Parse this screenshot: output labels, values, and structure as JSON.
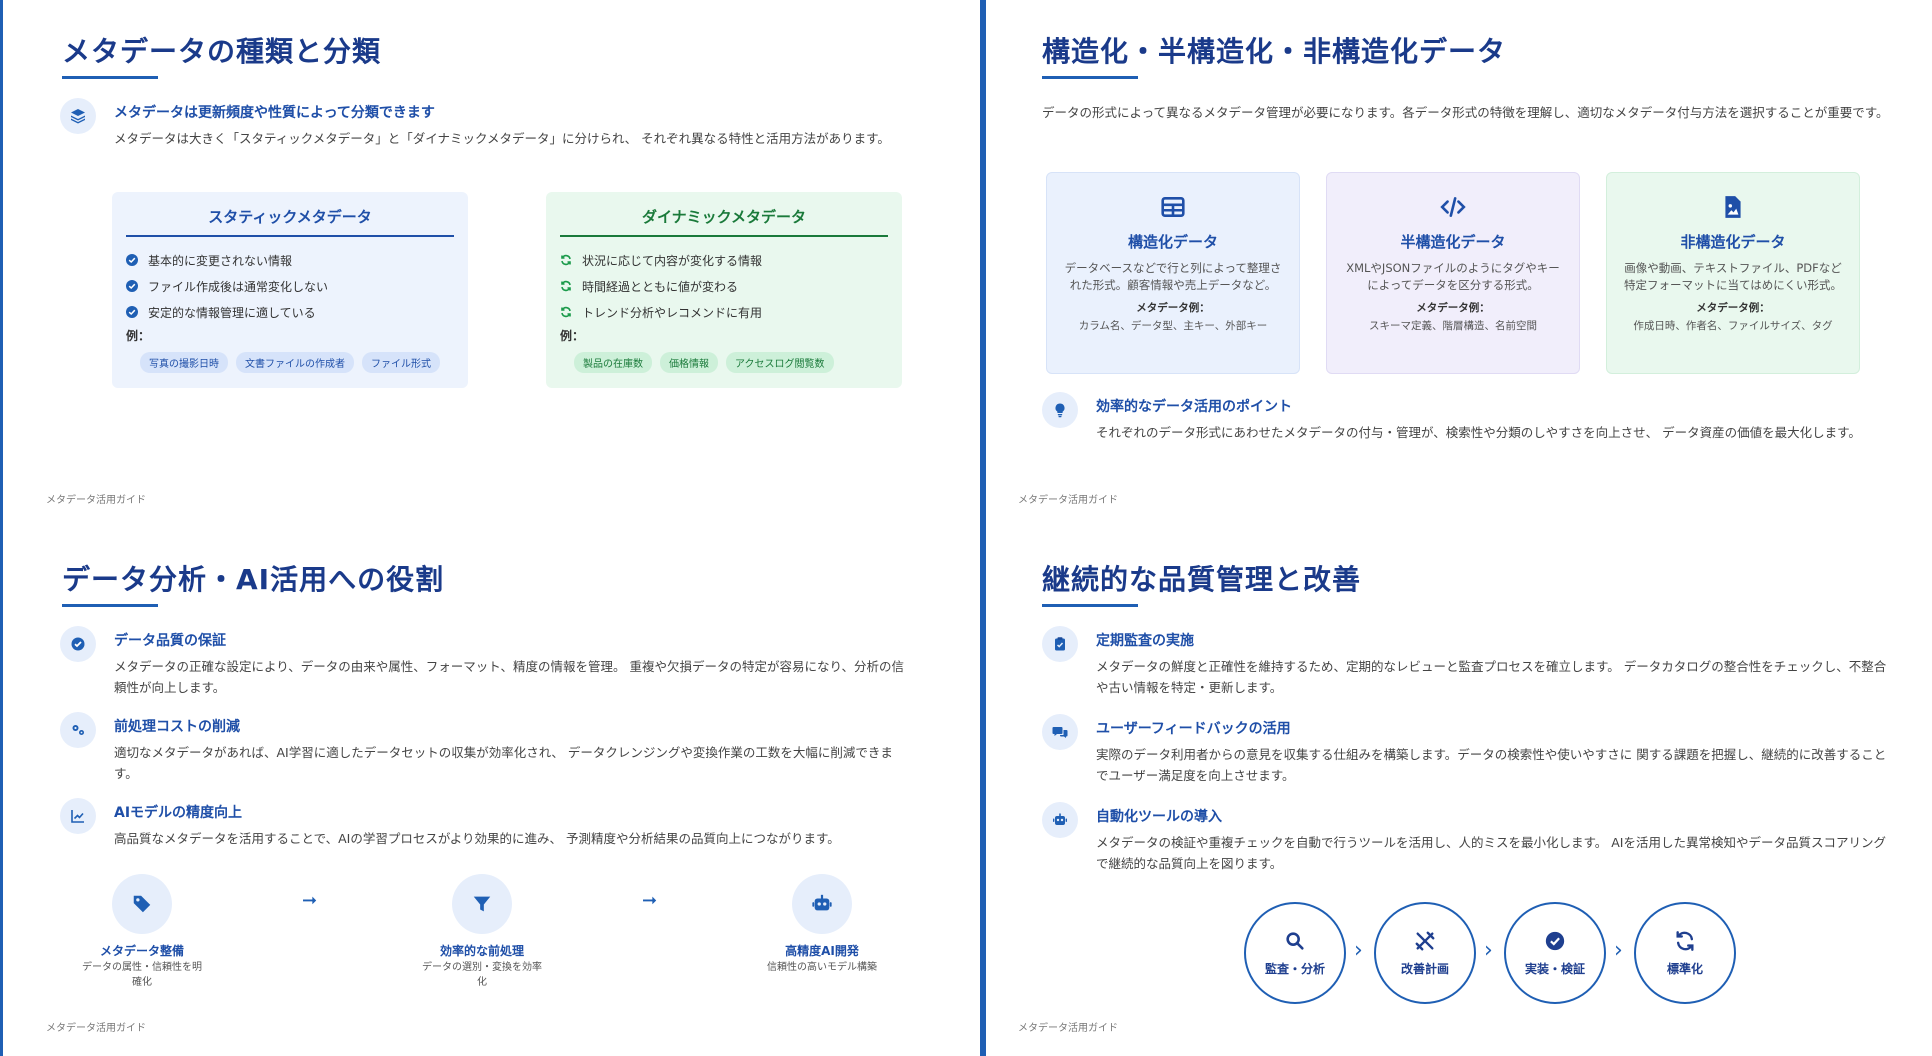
{
  "footer": "メタデータ活用ガイド",
  "slide1": {
    "title": "メタデータの種類と分類",
    "point_title": "メタデータは更新頻度や性質によって分類できます",
    "point_body": "メタデータは大きく「スタティックメタデータ」と「ダイナミックメタデータ」に分けられ、 それぞれ異なる特性と活用方法があります。",
    "static": {
      "title": "スタティックメタデータ",
      "items": [
        "基本的に変更されない情報",
        "ファイル作成後は通常変化しない",
        "安定的な情報管理に適している"
      ],
      "example_label": "例：",
      "tags": [
        "写真の撮影日時",
        "文書ファイルの作成者",
        "ファイル形式"
      ]
    },
    "dynamic": {
      "title": "ダイナミックメタデータ",
      "items": [
        "状況に応じて内容が変化する情報",
        "時間経過とともに値が変わる",
        "トレンド分析やレコメンドに有用"
      ],
      "example_label": "例：",
      "tags": [
        "製品の在庫数",
        "価格情報",
        "アクセスログ閲覧数"
      ]
    }
  },
  "slide2": {
    "title": "構造化・半構造化・非構造化データ",
    "intro": "データの形式によって異なるメタデータ管理が必要になります。各データ形式の特徴を理解し、適切なメタデータ付与方法を選択することが重要です。",
    "boxes": [
      {
        "title": "構造化データ",
        "desc": "データベースなどで行と列によって整理された形式。顧客情報や売上データなど。",
        "ex_label": "メタデータ例：",
        "ex": "カラム名、データ型、主キー、外部キー",
        "icon": "table-icon"
      },
      {
        "title": "半構造化データ",
        "desc": "XMLやJSONファイルのようにタグやキーによってデータを区分する形式。",
        "ex_label": "メタデータ例：",
        "ex": "スキーマ定義、階層構造、名前空間",
        "icon": "code-icon"
      },
      {
        "title": "非構造化データ",
        "desc": "画像や動画、テキストファイル、PDFなど特定フォーマットに当てはめにくい形式。",
        "ex_label": "メタデータ例：",
        "ex": "作成日時、作者名、ファイルサイズ、タグ",
        "icon": "image-file-icon"
      }
    ],
    "point_title": "効率的なデータ活用のポイント",
    "point_body": "それぞれのデータ形式にあわせたメタデータの付与・管理が、検索性や分類のしやすさを向上させ、 データ資産の価値を最大化します。"
  },
  "slide3": {
    "title": "データ分析・AI活用への役割",
    "points": [
      {
        "title": "データ品質の保証",
        "body": "メタデータの正確な設定により、データの由来や属性、フォーマット、精度の情報を管理。 重複や欠損データの特定が容易になり、分析の信頼性が向上します。"
      },
      {
        "title": "前処理コストの削減",
        "body": "適切なメタデータがあれば、AI学習に適したデータセットの収集が効率化され、 データクレンジングや変換作業の工数を大幅に削減できます。"
      },
      {
        "title": "AIモデルの精度向上",
        "body": "高品質なメタデータを活用することで、AIの学習プロセスがより効果的に進み、 予測精度や分析結果の品質向上につながります。"
      }
    ],
    "flow": [
      {
        "title": "メタデータ整備",
        "desc": "データの属性・信頼性を明確化"
      },
      {
        "title": "効率的な前処理",
        "desc": "データの選別・変換を効率化"
      },
      {
        "title": "高精度AI開発",
        "desc": "信頼性の高いモデル構築"
      }
    ]
  },
  "slide4": {
    "title": "継続的な品質管理と改善",
    "points": [
      {
        "title": "定期監査の実施",
        "body": "メタデータの鮮度と正確性を維持するため、定期的なレビューと監査プロセスを確立します。 データカタログの整合性をチェックし、不整合や古い情報を特定・更新します。"
      },
      {
        "title": "ユーザーフィードバックの活用",
        "body": "実際のデータ利用者からの意見を収集する仕組みを構築します。データの検索性や使いやすさに 関する課題を把握し、継続的に改善することでユーザー満足度を向上させます。"
      },
      {
        "title": "自動化ツールの導入",
        "body": "メタデータの検証や重複チェックを自動で行うツールを活用し、人的ミスを最小化します。 AIを活用した異常検知やデータ品質スコアリングで継続的な品質向上を図ります。"
      }
    ],
    "cycle": [
      "監査・分析",
      "改善計画",
      "実装・検証",
      "標準化"
    ]
  },
  "colors": {
    "accent": "#1f5fb4",
    "title": "#1a3a8a",
    "green": "#1a7a3a"
  }
}
